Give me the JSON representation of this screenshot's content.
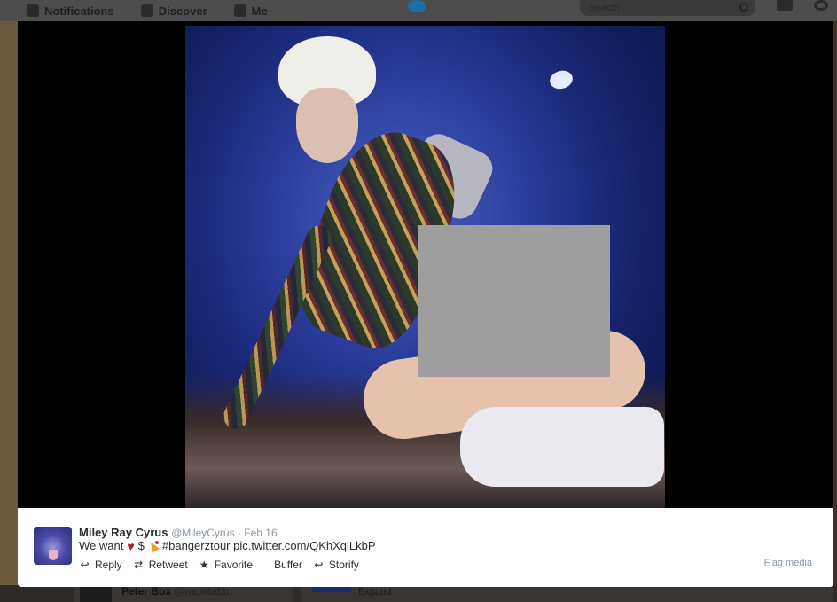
{
  "background": {
    "nav": [
      {
        "label": "Notifications",
        "icon": "bell-icon"
      },
      {
        "label": "Discover",
        "icon": "hashtag-icon"
      },
      {
        "label": "Me",
        "icon": "person-icon"
      }
    ],
    "search_placeholder": "Search",
    "bottom_card": {
      "name": "Peter Box",
      "handle": "@radiotabu",
      "expand_label": "Expand"
    }
  },
  "media": {
    "description": "stage photo",
    "censor_color": "#9e9e9e"
  },
  "tweet": {
    "name": "Miley Ray Cyrus",
    "handle": "@MileyCyrus",
    "separator": " · ",
    "date": "Feb 16",
    "text_prefix": "We want",
    "text_dollar": "$",
    "text_suffix": "#bangerztour pic.twitter.com/QKhXqiLkbP",
    "actions": [
      {
        "label": "Reply",
        "icon": "reply-icon"
      },
      {
        "label": "Retweet",
        "icon": "retweet-icon"
      },
      {
        "label": "Favorite",
        "icon": "star-icon"
      },
      {
        "label": "Buffer",
        "icon": ""
      },
      {
        "label": "Storify",
        "icon": "storify-icon"
      }
    ],
    "flag_label": "Flag media"
  }
}
